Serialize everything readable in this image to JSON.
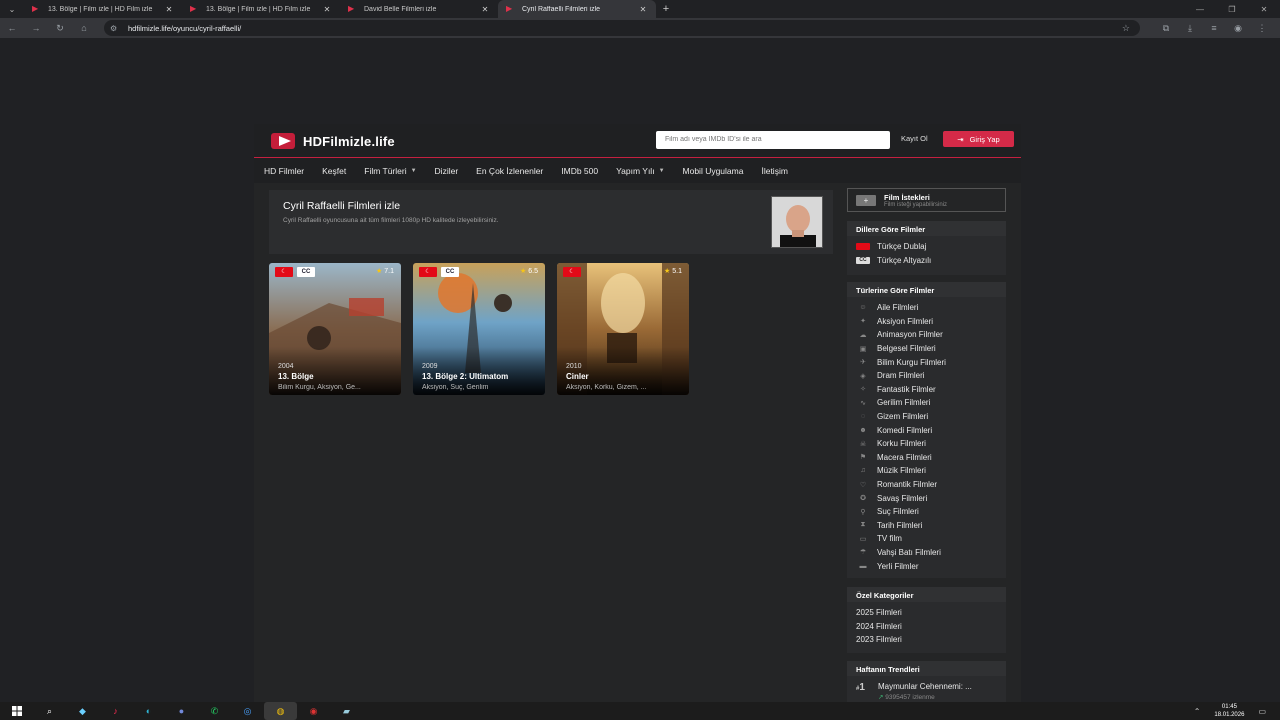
{
  "browser": {
    "tabs": [
      {
        "title": "13. Bölge | Film izle | HD Film izle",
        "active": false
      },
      {
        "title": "13. Bölge | Film izle | HD Film izle",
        "active": false
      },
      {
        "title": "David Belle Filmleri izle",
        "active": false
      },
      {
        "title": "Cyril Raffaelli Filmleri izle",
        "active": true
      }
    ],
    "url": "hdfilmizle.life/oyuncu/cyril-raffaelli/"
  },
  "site": {
    "logo_text": "HDFilmizle.life",
    "search_placeholder": "Film adı veya IMDb ID'si ile ara",
    "register_label": "Kayıt Ol",
    "login_label": "Giriş Yap",
    "menu": [
      {
        "label": "HD Filmler",
        "dropdown": false
      },
      {
        "label": "Keşfet",
        "dropdown": false
      },
      {
        "label": "Film Türleri",
        "dropdown": true
      },
      {
        "label": "Diziler",
        "dropdown": false
      },
      {
        "label": "En Çok İzlenenler",
        "dropdown": false
      },
      {
        "label": "IMDb 500",
        "dropdown": false
      },
      {
        "label": "Yapım Yılı",
        "dropdown": true
      },
      {
        "label": "Mobil Uygulama",
        "dropdown": false
      },
      {
        "label": "İletişim",
        "dropdown": false
      }
    ]
  },
  "actor": {
    "heading": "Cyril Raffaelli Filmleri izle",
    "description": "Cyril Raffaelli oyuncusuna ait tüm filmleri 1080p HD kalitede izleyebilirsiniz."
  },
  "movies": [
    {
      "year": "2004",
      "title": "13. Bölge",
      "genres": "Bilim Kurgu, Aksiyon, Ge...",
      "rating": "7.1",
      "dub": true,
      "sub": true
    },
    {
      "year": "2009",
      "title": "13. Bölge 2: Ultimatom",
      "genres": "Aksiyon, Suç, Gerilim",
      "rating": "6.5",
      "dub": true,
      "sub": true
    },
    {
      "year": "2010",
      "title": "Cinler",
      "genres": "Aksiyon, Korku, Gizem, ...",
      "rating": "5.1",
      "dub": true,
      "sub": false
    }
  ],
  "sidebar": {
    "request": {
      "title": "Film İstekleri",
      "subtitle": "Film isteği yapabilirsiniz"
    },
    "languages_title": "Dillere Göre Filmler",
    "languages": [
      "Türkçe Dublaj",
      "Türkçe Altyazılı"
    ],
    "genres_title": "Türlerine Göre Filmler",
    "genres": [
      {
        "label": "Aile Filmleri",
        "icon": "family-icon"
      },
      {
        "label": "Aksiyon Filmleri",
        "icon": "action-icon"
      },
      {
        "label": "Animasyon Filmler",
        "icon": "animation-icon"
      },
      {
        "label": "Belgesel Filmleri",
        "icon": "documentary-icon"
      },
      {
        "label": "Bilim Kurgu Filmleri",
        "icon": "scifi-icon"
      },
      {
        "label": "Dram Filmleri",
        "icon": "drama-icon"
      },
      {
        "label": "Fantastik Filmler",
        "icon": "fantasy-icon"
      },
      {
        "label": "Gerilim Filmleri",
        "icon": "thriller-icon"
      },
      {
        "label": "Gizem Filmleri",
        "icon": "mystery-icon"
      },
      {
        "label": "Komedi Filmleri",
        "icon": "comedy-icon"
      },
      {
        "label": "Korku Filmleri",
        "icon": "horror-icon"
      },
      {
        "label": "Macera Filmleri",
        "icon": "adventure-icon"
      },
      {
        "label": "Müzik Filmleri",
        "icon": "music-icon"
      },
      {
        "label": "Romantik Filmler",
        "icon": "romance-icon"
      },
      {
        "label": "Savaş Filmleri",
        "icon": "war-icon"
      },
      {
        "label": "Suç Filmleri",
        "icon": "crime-icon"
      },
      {
        "label": "Tarih Filmleri",
        "icon": "history-icon"
      },
      {
        "label": "TV film",
        "icon": "tv-icon"
      },
      {
        "label": "Vahşi Batı Filmleri",
        "icon": "western-icon"
      },
      {
        "label": "Yerli Filmler",
        "icon": "local-icon"
      }
    ],
    "special_title": "Özel Kategoriler",
    "special": [
      "2025 Filmleri",
      "2024 Filmleri",
      "2023 Filmleri"
    ],
    "trend_title": "Haftanın Trendleri",
    "trend": {
      "rank": "1",
      "title": "Maymunlar Cehennemi: ...",
      "views": "9395457 izlenme"
    }
  },
  "taskbar": {
    "time": "01:45",
    "date": "18.01.2026"
  }
}
